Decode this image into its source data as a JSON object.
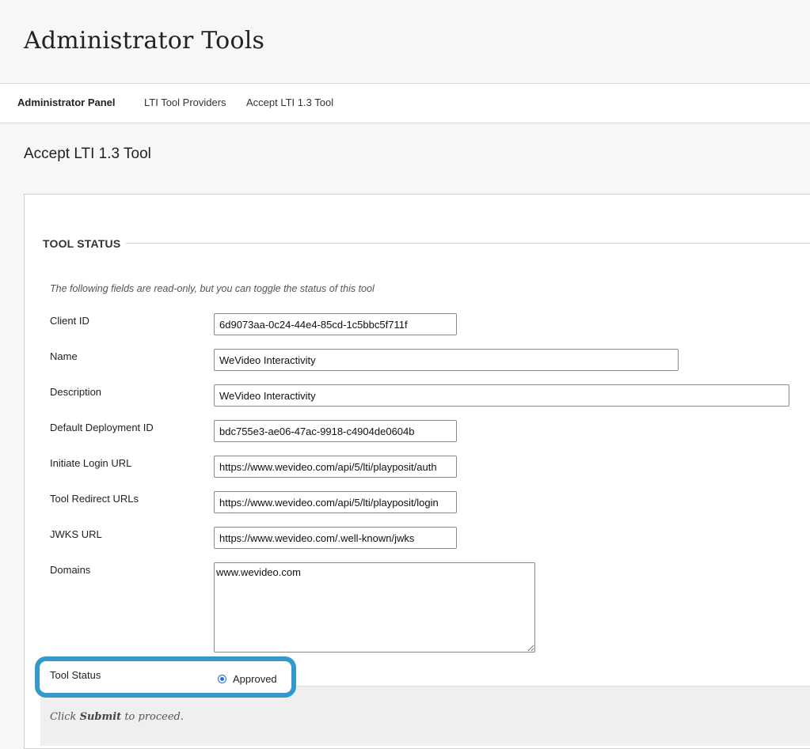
{
  "header": {
    "title": "Administrator Tools"
  },
  "breadcrumb": {
    "items": [
      {
        "label": "Administrator Panel"
      },
      {
        "label": "LTI Tool Providers"
      },
      {
        "label": "Accept LTI 1.3 Tool"
      }
    ]
  },
  "page": {
    "title": "Accept LTI 1.3 Tool"
  },
  "form": {
    "legend": "TOOL STATUS",
    "instructions": "The following fields are read-only, but you can toggle the status of this tool",
    "fields": {
      "client_id": {
        "label": "Client ID",
        "value": "6d9073aa-0c24-44e4-85cd-1c5bbc5f711f"
      },
      "name": {
        "label": "Name",
        "value": "WeVideo Interactivity"
      },
      "description": {
        "label": "Description",
        "value": "WeVideo Interactivity"
      },
      "deployment_id": {
        "label": "Default Deployment ID",
        "value": "bdc755e3-ae06-47ac-9918-c4904de0604b"
      },
      "login_url": {
        "label": "Initiate Login URL",
        "value": "https://www.wevideo.com/api/5/lti/playposit/auth"
      },
      "redirect_urls": {
        "label": "Tool Redirect URLs",
        "value": "https://www.wevideo.com/api/5/lti/playposit/login"
      },
      "jwks_url": {
        "label": "JWKS URL",
        "value": "https://www.wevideo.com/.well-known/jwks"
      },
      "domains": {
        "label": "Domains",
        "value": "www.wevideo.com"
      }
    },
    "tool_status": {
      "label": "Tool Status",
      "selected": "Approved"
    }
  },
  "submit": {
    "prefix": "Click ",
    "action": "Submit",
    "suffix": " to proceed."
  },
  "colors": {
    "highlight": "#3399cc",
    "radio": "#1a73e8"
  }
}
